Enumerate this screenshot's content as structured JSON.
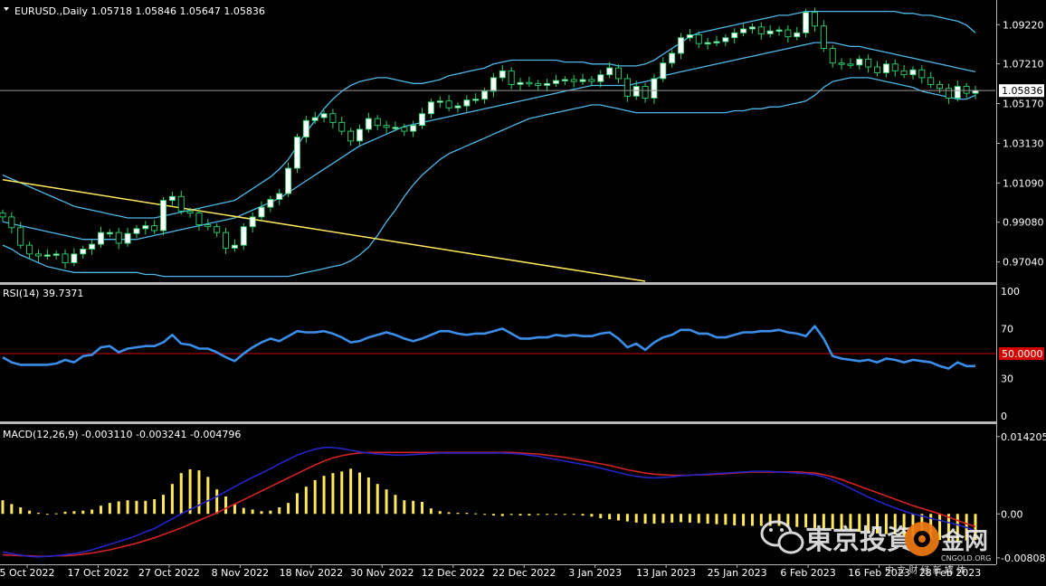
{
  "chart_data": [
    {
      "type": "candlestick",
      "header": "EURUSD.,Daily  1.05718 1.05846 1.05647 1.05836",
      "ylim": [
        0.9605,
        1.103
      ],
      "y_ticks": [
        "0.97040",
        "0.99080",
        "1.01090",
        "1.03130",
        "1.05170",
        "1.07210",
        "1.09220"
      ],
      "y_tick_values": [
        0.9704,
        0.9908,
        1.0109,
        1.0313,
        1.0517,
        1.0721,
        1.0922
      ],
      "last_price": "1.05836",
      "last_price_value": 1.05836,
      "x_ticks": [
        "5 Oct 2022",
        "17 Oct 2022",
        "27 Oct 2022",
        "8 Nov 2022",
        "18 Nov 2022",
        "30 Nov 2022",
        "12 Dec 2022",
        "22 Dec 2022",
        "3 Jan 2023",
        "13 Jan 2023",
        "25 Jan 2023",
        "6 Feb 2023",
        "16 Feb 2023",
        "28 Feb 2023"
      ],
      "close": [
        0.9935,
        0.988,
        0.979,
        0.9745,
        0.9735,
        0.974,
        0.9745,
        0.97,
        0.9745,
        0.977,
        0.9795,
        0.9855,
        0.9855,
        0.98,
        0.985,
        0.9875,
        0.989,
        0.9865,
        1.002,
        1.004,
        0.9965,
        0.9955,
        0.9895,
        0.9885,
        0.9855,
        0.9775,
        0.979,
        0.9885,
        0.9935,
        0.9985,
        1.0025,
        1.0055,
        1.0185,
        1.0345,
        1.043,
        1.0445,
        1.0465,
        1.042,
        1.0375,
        1.0325,
        1.0385,
        1.044,
        1.0405,
        1.0395,
        1.0395,
        1.0375,
        1.0405,
        1.0465,
        1.0525,
        1.053,
        1.0495,
        1.0505,
        1.0535,
        1.054,
        1.058,
        1.065,
        1.0685,
        1.0615,
        1.0625,
        1.062,
        1.061,
        1.062,
        1.0635,
        1.064,
        1.063,
        1.064,
        1.063,
        1.0665,
        1.07,
        1.0645,
        1.0555,
        1.0605,
        1.0545,
        1.0645,
        1.0725,
        1.0775,
        1.0855,
        1.087,
        1.0825,
        1.083,
        1.0835,
        1.0855,
        1.088,
        1.09,
        1.091,
        1.0875,
        1.089,
        1.0895,
        1.086,
        1.088,
        1.0985,
        1.0915,
        1.08,
        1.0725,
        1.072,
        1.0715,
        1.0745,
        1.0705,
        1.0675,
        1.072,
        1.0685,
        1.0665,
        1.069,
        1.065,
        1.0615,
        1.0595,
        1.0545,
        1.0605,
        1.057,
        1.0584
      ],
      "bands_upper": [
        1.015,
        1.013,
        1.011,
        1.009,
        1.007,
        1.005,
        1.003,
        1.001,
        0.999,
        0.998,
        0.997,
        0.996,
        0.995,
        0.994,
        0.993,
        0.993,
        0.993,
        0.993,
        0.994,
        0.995,
        0.996,
        0.997,
        0.998,
        0.999,
        1.0,
        1.001,
        1.002,
        1.005,
        1.008,
        1.011,
        1.014,
        1.018,
        1.023,
        1.03,
        1.037,
        1.043,
        1.049,
        1.054,
        1.058,
        1.061,
        1.063,
        1.064,
        1.065,
        1.065,
        1.064,
        1.063,
        1.062,
        1.062,
        1.063,
        1.064,
        1.066,
        1.067,
        1.068,
        1.069,
        1.07,
        1.072,
        1.073,
        1.074,
        1.074,
        1.074,
        1.074,
        1.074,
        1.074,
        1.073,
        1.073,
        1.073,
        1.072,
        1.072,
        1.072,
        1.071,
        1.071,
        1.071,
        1.072,
        1.074,
        1.077,
        1.08,
        1.083,
        1.086,
        1.088,
        1.089,
        1.09,
        1.091,
        1.092,
        1.093,
        1.094,
        1.095,
        1.096,
        1.097,
        1.097,
        1.098,
        1.099,
        1.099,
        1.099,
        1.099,
        1.099,
        1.099,
        1.099,
        1.099,
        1.099,
        1.099,
        1.099,
        1.098,
        1.098,
        1.097,
        1.097,
        1.096,
        1.095,
        1.094,
        1.092,
        1.088
      ],
      "bands_middle": [
        0.991,
        0.99,
        0.989,
        0.988,
        0.987,
        0.986,
        0.985,
        0.984,
        0.983,
        0.982,
        0.982,
        0.982,
        0.982,
        0.982,
        0.982,
        0.982,
        0.983,
        0.984,
        0.985,
        0.986,
        0.987,
        0.988,
        0.989,
        0.99,
        0.991,
        0.992,
        0.993,
        0.995,
        0.997,
        0.999,
        1.001,
        1.003,
        1.006,
        1.009,
        1.012,
        1.015,
        1.018,
        1.021,
        1.024,
        1.027,
        1.03,
        1.032,
        1.034,
        1.036,
        1.038,
        1.04,
        1.041,
        1.042,
        1.043,
        1.044,
        1.045,
        1.046,
        1.047,
        1.048,
        1.049,
        1.05,
        1.051,
        1.052,
        1.053,
        1.054,
        1.055,
        1.056,
        1.057,
        1.058,
        1.059,
        1.06,
        1.061,
        1.061,
        1.061,
        1.061,
        1.061,
        1.062,
        1.063,
        1.064,
        1.066,
        1.067,
        1.068,
        1.069,
        1.07,
        1.071,
        1.072,
        1.073,
        1.074,
        1.075,
        1.076,
        1.077,
        1.078,
        1.079,
        1.08,
        1.081,
        1.082,
        1.083,
        1.083,
        1.083,
        1.082,
        1.081,
        1.081,
        1.08,
        1.079,
        1.078,
        1.077,
        1.076,
        1.075,
        1.074,
        1.073,
        1.072,
        1.071,
        1.07,
        1.069,
        1.068
      ],
      "bands_lower": [
        0.979,
        0.977,
        0.974,
        0.972,
        0.97,
        0.968,
        0.967,
        0.966,
        0.965,
        0.965,
        0.965,
        0.965,
        0.965,
        0.965,
        0.965,
        0.965,
        0.964,
        0.964,
        0.963,
        0.963,
        0.963,
        0.963,
        0.963,
        0.963,
        0.963,
        0.963,
        0.963,
        0.963,
        0.963,
        0.963,
        0.963,
        0.963,
        0.963,
        0.964,
        0.965,
        0.966,
        0.967,
        0.968,
        0.969,
        0.971,
        0.974,
        0.978,
        0.984,
        0.991,
        0.997,
        1.004,
        1.01,
        1.015,
        1.019,
        1.023,
        1.026,
        1.028,
        1.03,
        1.032,
        1.034,
        1.036,
        1.038,
        1.04,
        1.042,
        1.044,
        1.045,
        1.046,
        1.047,
        1.048,
        1.049,
        1.05,
        1.051,
        1.051,
        1.05,
        1.049,
        1.048,
        1.047,
        1.047,
        1.047,
        1.047,
        1.047,
        1.047,
        1.047,
        1.047,
        1.047,
        1.047,
        1.047,
        1.048,
        1.048,
        1.049,
        1.049,
        1.05,
        1.05,
        1.051,
        1.052,
        1.053,
        1.056,
        1.06,
        1.063,
        1.064,
        1.065,
        1.065,
        1.065,
        1.064,
        1.063,
        1.062,
        1.061,
        1.06,
        1.058,
        1.057,
        1.056,
        1.055,
        1.054,
        1.054,
        1.056
      ],
      "trendline": [
        [
          0,
          1.0126
        ],
        [
          72,
          0.9605
        ]
      ]
    },
    {
      "type": "line",
      "header": "RSI(14) 39.7371",
      "ylim": [
        0,
        100
      ],
      "y_ticks": [
        "0",
        "30",
        "50.0000",
        "70",
        "100"
      ],
      "y_tick_values": [
        0,
        30,
        50,
        70,
        100
      ],
      "level": 50,
      "values": [
        47,
        43,
        41,
        41,
        41,
        41,
        42,
        45,
        43,
        48,
        49,
        55,
        56,
        51,
        54,
        55,
        56,
        56,
        59,
        65,
        58,
        57,
        54,
        54,
        51,
        47,
        44,
        50,
        55,
        59,
        62,
        60,
        64,
        68,
        67,
        67,
        68,
        66,
        63,
        59,
        60,
        63,
        65,
        67,
        65,
        62,
        60,
        62,
        65,
        68,
        68,
        66,
        65,
        66,
        66,
        68,
        70,
        66,
        62,
        62,
        63,
        63,
        65,
        64,
        65,
        64,
        64,
        66,
        67,
        62,
        55,
        58,
        53,
        59,
        63,
        65,
        69,
        69,
        66,
        66,
        63,
        63,
        65,
        67,
        67,
        68,
        68,
        69,
        67,
        66,
        64,
        72,
        62,
        48,
        46,
        45,
        44,
        45,
        43,
        46,
        45,
        43,
        45,
        44,
        43,
        40,
        38,
        43,
        40,
        40
      ]
    },
    {
      "type": "bar+line",
      "header": "MACD(12,26,9) -0.003110 -0.003241 -0.004796",
      "ylim": [
        -0.0086,
        0.015
      ],
      "y_ticks": [
        "0.014205",
        "0.00",
        "-0.008088"
      ],
      "y_tick_values": [
        0.014205,
        0.0,
        -0.008088
      ],
      "histogram": [
        0.0025,
        0.0018,
        0.0012,
        0.0006,
        0.0002,
        -0.0001,
        0.0001,
        0.0004,
        0.0005,
        0.0006,
        0.0008,
        0.0015,
        0.002,
        0.0023,
        0.0025,
        0.0024,
        0.0024,
        0.0027,
        0.0035,
        0.0055,
        0.0075,
        0.0082,
        0.008,
        0.0068,
        0.0045,
        0.0032,
        0.0018,
        0.0011,
        0.0008,
        0.0005,
        0.0006,
        0.0012,
        0.002,
        0.0038,
        0.005,
        0.0062,
        0.007,
        0.0075,
        0.0078,
        0.0083,
        0.0076,
        0.0067,
        0.0055,
        0.0045,
        0.0035,
        0.0025,
        0.0024,
        0.0022,
        0.001,
        0.0005,
        0.0003,
        0.0002,
        0.0002,
        0.0001,
        0.0,
        -0.0003,
        -0.0004,
        -0.0002,
        -0.0003,
        -0.0003,
        -0.0002,
        -0.0001,
        -0.0001,
        0.0,
        -0.0001,
        -0.0003,
        -0.0005,
        -0.0008,
        -0.001,
        -0.0012,
        -0.0014,
        -0.0016,
        -0.0018,
        -0.0018,
        -0.0017,
        -0.0016,
        -0.0015,
        -0.0016,
        -0.0017,
        -0.0018,
        -0.0019,
        -0.002,
        -0.0021,
        -0.0022,
        -0.0022,
        -0.0022,
        -0.0022,
        -0.0022,
        -0.0023,
        -0.0024,
        -0.0025,
        -0.0026,
        -0.0027,
        -0.0028,
        -0.003,
        -0.0032,
        -0.0033,
        -0.0035,
        -0.0036,
        -0.0037,
        -0.0038,
        -0.004,
        -0.0042,
        -0.0044,
        -0.0046,
        -0.0048,
        -0.005,
        -0.0051,
        -0.0049,
        -0.0048
      ],
      "macd_line": [
        -0.007,
        -0.0073,
        -0.0076,
        -0.0078,
        -0.0079,
        -0.0078,
        -0.0077,
        -0.0075,
        -0.0073,
        -0.007,
        -0.0066,
        -0.0061,
        -0.0056,
        -0.0051,
        -0.0046,
        -0.004,
        -0.0033,
        -0.0027,
        -0.0018,
        -0.0009,
        0.0,
        0.0008,
        0.0016,
        0.0024,
        0.0032,
        0.0041,
        0.005,
        0.0059,
        0.0067,
        0.0075,
        0.0083,
        0.0092,
        0.01,
        0.0108,
        0.0114,
        0.0119,
        0.0122,
        0.0122,
        0.012,
        0.0117,
        0.0114,
        0.0112,
        0.011,
        0.0109,
        0.0108,
        0.0108,
        0.0109,
        0.011,
        0.0111,
        0.0112,
        0.0112,
        0.0112,
        0.0112,
        0.0112,
        0.0112,
        0.0112,
        0.0112,
        0.0111,
        0.011,
        0.0108,
        0.0106,
        0.0103,
        0.01,
        0.0097,
        0.0094,
        0.0091,
        0.0088,
        0.0084,
        0.008,
        0.0076,
        0.0072,
        0.0069,
        0.0067,
        0.0066,
        0.0067,
        0.0068,
        0.007,
        0.0071,
        0.0072,
        0.0073,
        0.0074,
        0.0075,
        0.0076,
        0.0077,
        0.0078,
        0.0078,
        0.0078,
        0.0077,
        0.0076,
        0.0075,
        0.0074,
        0.0072,
        0.0068,
        0.0062,
        0.0055,
        0.0047,
        0.0039,
        0.0031,
        0.0024,
        0.0017,
        0.0011,
        0.0005,
        0.0,
        -0.0004,
        -0.0008,
        -0.0012,
        -0.0016,
        -0.002,
        -0.0025,
        -0.0031
      ],
      "signal_line": [
        -0.0075,
        -0.0076,
        -0.0077,
        -0.0077,
        -0.0078,
        -0.0078,
        -0.0077,
        -0.0077,
        -0.0076,
        -0.0074,
        -0.0072,
        -0.0069,
        -0.0066,
        -0.0062,
        -0.0058,
        -0.0054,
        -0.0049,
        -0.0044,
        -0.0038,
        -0.0032,
        -0.0026,
        -0.0019,
        -0.0012,
        -0.0005,
        0.0002,
        0.001,
        0.0018,
        0.0026,
        0.0034,
        0.0042,
        0.005,
        0.0058,
        0.0066,
        0.0074,
        0.0082,
        0.009,
        0.0097,
        0.0103,
        0.0107,
        0.011,
        0.0112,
        0.0113,
        0.0113,
        0.0113,
        0.0113,
        0.0113,
        0.0113,
        0.0113,
        0.0113,
        0.0113,
        0.0113,
        0.0113,
        0.0113,
        0.0113,
        0.0113,
        0.0113,
        0.0113,
        0.0113,
        0.0112,
        0.0111,
        0.011,
        0.0108,
        0.0106,
        0.0104,
        0.0101,
        0.0098,
        0.0095,
        0.0092,
        0.0089,
        0.0085,
        0.0081,
        0.0078,
        0.0075,
        0.0073,
        0.0072,
        0.0071,
        0.0071,
        0.0071,
        0.0072,
        0.0072,
        0.0073,
        0.0074,
        0.0075,
        0.0076,
        0.0077,
        0.0077,
        0.0077,
        0.0077,
        0.0077,
        0.0077,
        0.0076,
        0.0075,
        0.0072,
        0.0068,
        0.0063,
        0.0057,
        0.0051,
        0.0045,
        0.0039,
        0.0033,
        0.0027,
        0.0021,
        0.0015,
        0.001,
        0.0005,
        0.0,
        -0.0006,
        -0.0012,
        -0.0018,
        -0.0023
      ]
    }
  ],
  "colors": {
    "background": "#000000",
    "grid_divider": "#b8b8b8",
    "bull_candle": "#ffffff",
    "bear_candle": "#000000",
    "wick": "#2bd36e",
    "bollinger": "#4fb8e8",
    "trendline": "#ffe85a",
    "rsi_line": "#3a8eea",
    "rsi_level": "#d40000",
    "price_tag_bg": "#ffffff",
    "price_tag_text": "#000000",
    "histogram": "#ffe85a",
    "macd_line": "#2424c8",
    "signal_line": "#d42222"
  },
  "watermark": {
    "main": "東京投資",
    "brand": "金网",
    "brand_sub": "CNGOLD.ORG",
    "brand_sub2": "中 立 财 经 新 媒 体"
  }
}
